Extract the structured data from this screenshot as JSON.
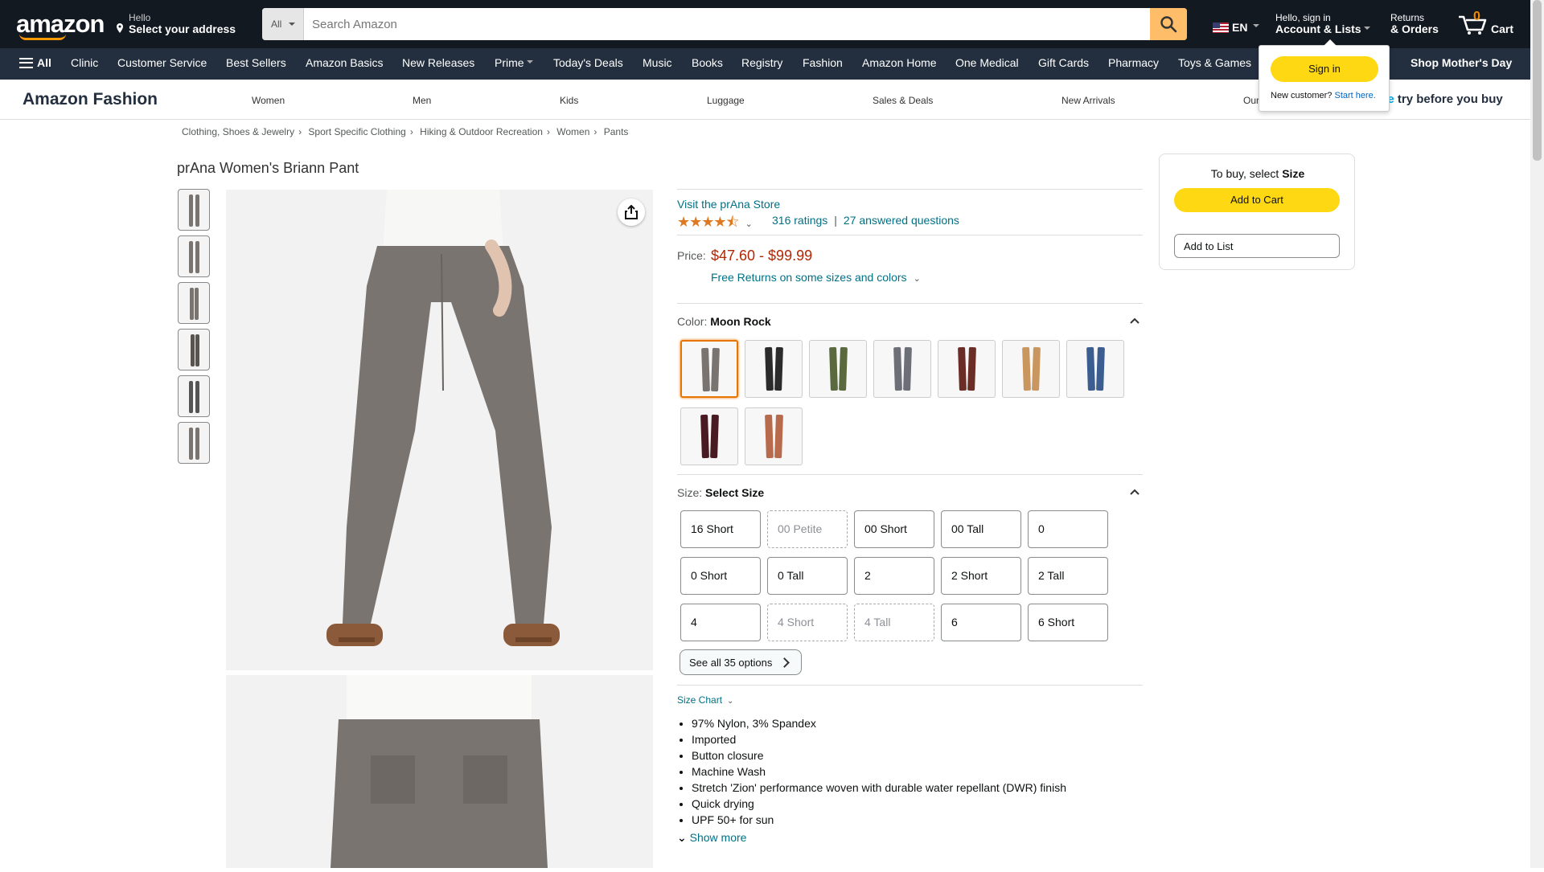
{
  "header": {
    "logo": "amazon",
    "deliver_hello": "Hello",
    "deliver_address": "Select your address",
    "search_category": "All",
    "search_placeholder": "Search Amazon",
    "language": "EN",
    "account_hello": "Hello, sign in",
    "account_label": "Account & Lists",
    "returns_top": "Returns",
    "returns_bottom": "& Orders",
    "cart_count": "0",
    "cart_label": "Cart"
  },
  "nav": {
    "all_label": "All",
    "items": [
      "Clinic",
      "Customer Service",
      "Best Sellers",
      "Amazon Basics",
      "New Releases",
      "Prime",
      "Today's Deals",
      "Music",
      "Books",
      "Registry",
      "Fashion",
      "Amazon Home",
      "One Medical",
      "Gift Cards",
      "Pharmacy",
      "Toys & Games"
    ],
    "promo": "Shop Mother's Day"
  },
  "flyout": {
    "signin": "Sign in",
    "new_customer": "New customer?",
    "start_here": "Start here."
  },
  "subnav": {
    "title": "Amazon Fashion",
    "links": [
      "Women",
      "Men",
      "Kids",
      "Luggage",
      "Sales & Deals",
      "New Arrivals",
      "Our"
    ],
    "try_before_prefix": "me",
    "try_before": " try before you buy"
  },
  "breadcrumb": [
    "Clothing, Shoes & Jewelry",
    "Sport Specific Clothing",
    "Hiking & Outdoor Recreation",
    "Women",
    "Pants"
  ],
  "product": {
    "title": "prAna Women's Briann Pant",
    "store_link": "Visit the prAna Store",
    "stars": "★★★★⯪",
    "rating_count": "316 ratings",
    "answered": "27 answered questions",
    "price_label": "Price:",
    "price": "$47.60 - $99.99",
    "free_returns": "Free Returns on some sizes and colors",
    "color_label": "Color:",
    "color_value": "Moon Rock",
    "swatches": [
      {
        "color": "#7a7470",
        "selected": true
      },
      {
        "color": "#2b2b2b",
        "selected": false
      },
      {
        "color": "#5a6a3e",
        "selected": false
      },
      {
        "color": "#6d6f78",
        "selected": false
      },
      {
        "color": "#6b2e26",
        "selected": false
      },
      {
        "color": "#c8965e",
        "selected": false
      },
      {
        "color": "#3b5d8f",
        "selected": false
      },
      {
        "color": "#4a1a22",
        "selected": false
      },
      {
        "color": "#b86a4c",
        "selected": false
      }
    ],
    "size_label": "Size:",
    "size_value": "Select Size",
    "sizes": [
      {
        "label": "16 Short",
        "available": true
      },
      {
        "label": "00 Petite",
        "available": false
      },
      {
        "label": "00 Short",
        "available": true
      },
      {
        "label": "00 Tall",
        "available": true
      },
      {
        "label": "0",
        "available": true
      },
      {
        "label": "0 Short",
        "available": true
      },
      {
        "label": "0 Tall",
        "available": true
      },
      {
        "label": "2",
        "available": true
      },
      {
        "label": "2 Short",
        "available": true
      },
      {
        "label": "2 Tall",
        "available": true
      },
      {
        "label": "4",
        "available": true
      },
      {
        "label": "4 Short",
        "available": false
      },
      {
        "label": "4 Tall",
        "available": false
      },
      {
        "label": "6",
        "available": true
      },
      {
        "label": "6 Short",
        "available": true
      }
    ],
    "see_all": "See all 35 options",
    "size_chart": "Size Chart",
    "bullets": [
      "97% Nylon, 3% Spandex",
      "Imported",
      "Button closure",
      "Machine Wash",
      "Stretch 'Zion' performance woven with durable water repellant (DWR) finish",
      "Quick drying",
      "UPF 50+ for sun"
    ],
    "show_more": "Show more"
  },
  "buybox": {
    "title_prefix": "To buy, select ",
    "title_bold": "Size",
    "add_to_cart": "Add to Cart",
    "add_to_list": "Add to List"
  },
  "colors": {
    "nav_dark": "#131921",
    "nav_secondary": "#232f3e",
    "accent_orange": "#ff9900",
    "button_yellow": "#ffd814",
    "link_teal": "#007185",
    "price_red": "#b12704"
  }
}
